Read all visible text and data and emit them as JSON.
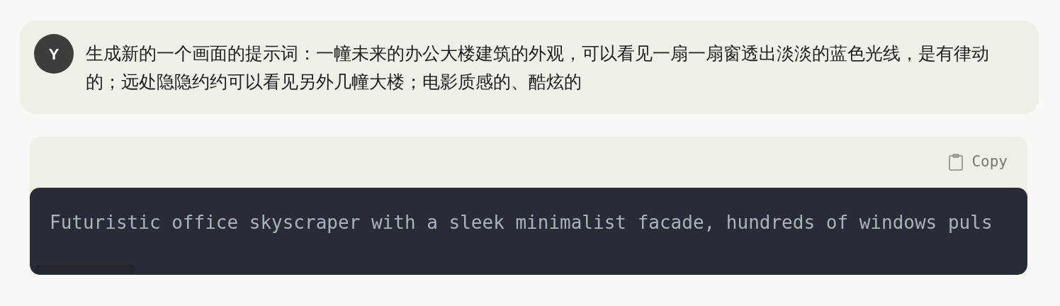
{
  "message": {
    "avatar": "Y",
    "text": "生成新的一个画面的提示词：一幢未来的办公大楼建筑的外观，可以看见一扇一扇窗透出淡淡的蓝色光线，是有律动的；远处隐隐约约可以看见另外几幢大楼；电影质感的、酷炫的"
  },
  "code_block": {
    "copy_label": "Copy",
    "code": "Futuristic office skyscraper with a sleek minimalist facade, hundreds of windows puls"
  }
}
